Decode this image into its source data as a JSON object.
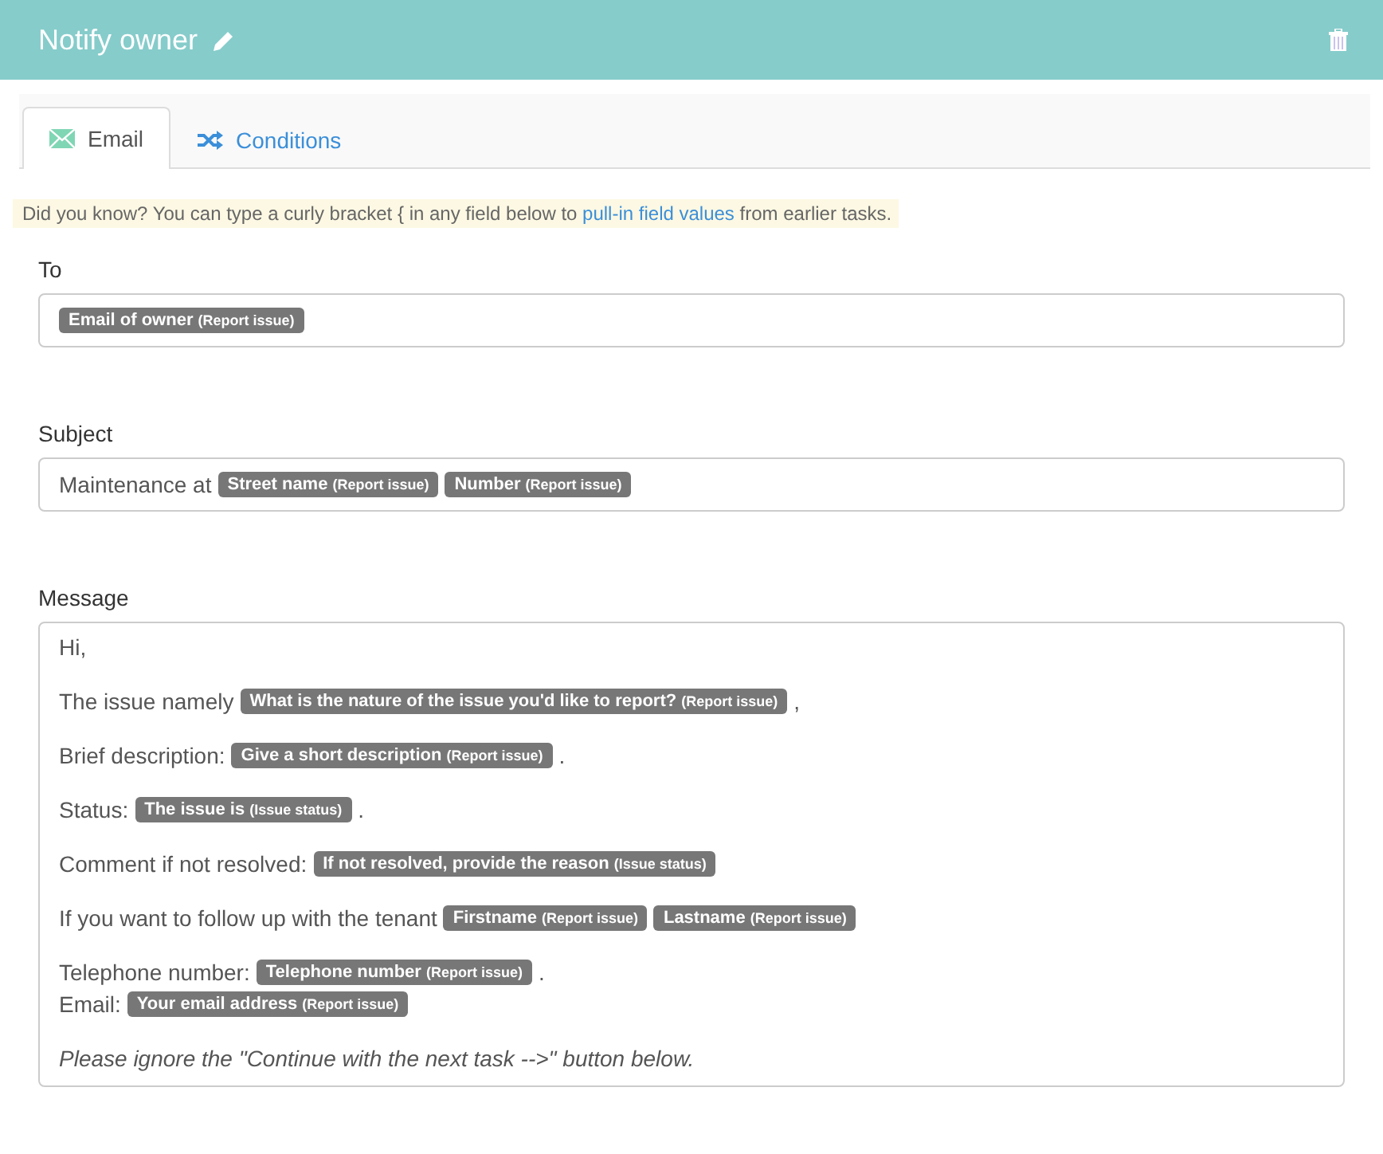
{
  "header": {
    "title": "Notify owner"
  },
  "tabs": [
    {
      "label": "Email",
      "kind": "mail",
      "selected": true
    },
    {
      "label": "Conditions",
      "kind": "rule",
      "selected": false
    }
  ],
  "hint": {
    "before": "Did you know? You can type a curly bracket { in any field below to ",
    "link": "pull-in field values",
    "after": " from earlier tasks."
  },
  "fields": [
    {
      "label": "To",
      "segments": [
        {
          "kind": "tag",
          "label": "Email of owner",
          "source": "(Report issue)"
        }
      ]
    },
    {
      "label": "Subject",
      "segments": [
        {
          "kind": "text",
          "text": "Maintenance at"
        },
        {
          "kind": "tag",
          "label": "Street name",
          "source": "(Report issue)"
        },
        {
          "kind": "tag",
          "label": "Number",
          "source": "(Report issue)"
        }
      ]
    }
  ],
  "message": {
    "label": "Message",
    "paragraphs": [
      {
        "kind": "plain",
        "lines": [
          [
            {
              "kind": "text",
              "text": "Hi,"
            }
          ]
        ]
      },
      {
        "kind": "plain",
        "lines": [
          [
            {
              "kind": "text",
              "text": "The issue namely"
            },
            {
              "kind": "tag",
              "label": "What is the nature of the issue you'd like to report?",
              "source": "(Report issue)"
            },
            {
              "kind": "text",
              "text": ","
            }
          ]
        ]
      },
      {
        "kind": "plain",
        "lines": [
          [
            {
              "kind": "text",
              "text": "Brief description:"
            },
            {
              "kind": "tag",
              "label": "Give a short description",
              "source": "(Report issue)"
            },
            {
              "kind": "text",
              "text": "."
            }
          ]
        ]
      },
      {
        "kind": "plain",
        "lines": [
          [
            {
              "kind": "text",
              "text": "Status:"
            },
            {
              "kind": "tag",
              "label": "The issue is",
              "source": "(Issue status)"
            },
            {
              "kind": "text",
              "text": "."
            }
          ]
        ]
      },
      {
        "kind": "plain",
        "lines": [
          [
            {
              "kind": "text",
              "text": "Comment if not resolved:"
            },
            {
              "kind": "tag",
              "label": "If not resolved, provide the reason",
              "source": "(Issue status)"
            }
          ]
        ]
      },
      {
        "kind": "plain",
        "lines": [
          [
            {
              "kind": "text",
              "text": "If you want to follow up with the tenant"
            },
            {
              "kind": "tag",
              "label": "Firstname",
              "source": "(Report issue)"
            },
            {
              "kind": "tag",
              "label": "Lastname",
              "source": "(Report issue)"
            }
          ]
        ]
      },
      {
        "kind": "plain",
        "lines": [
          [
            {
              "kind": "text",
              "text": "Telephone number:"
            },
            {
              "kind": "tag",
              "label": "Telephone number",
              "source": "(Report issue)"
            },
            {
              "kind": "text",
              "text": "."
            }
          ],
          [
            {
              "kind": "text",
              "text": "Email:"
            },
            {
              "kind": "tag",
              "label": "Your email address",
              "source": "(Report issue)"
            }
          ]
        ]
      },
      {
        "kind": "note",
        "lines": [
          [
            {
              "kind": "text",
              "text": "Please ignore the \"Continue with the next task -->\" button below."
            }
          ]
        ]
      }
    ]
  }
}
